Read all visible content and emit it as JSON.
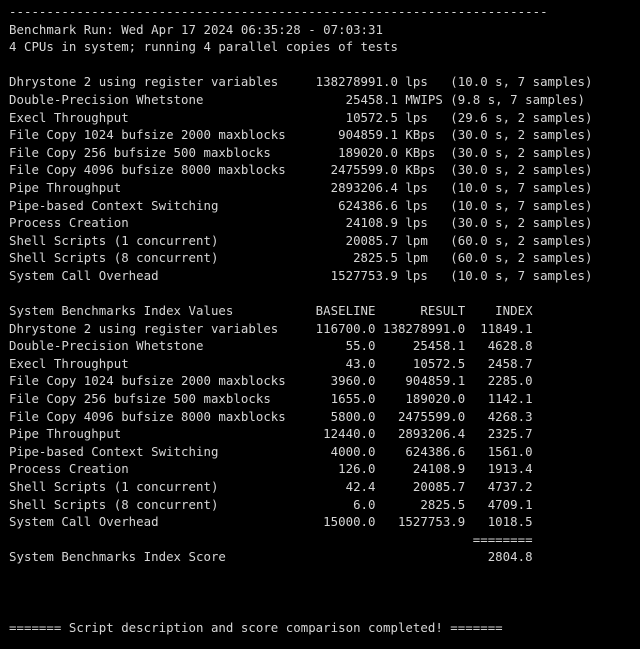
{
  "terminal": {
    "background_color": "#000000",
    "text_color": "#d6d6d6",
    "separator_top": "------------------------------------------------------------------------",
    "benchmark_run_line": "Benchmark Run: Wed Apr 17 2024 06:35:28 - 07:03:31",
    "cpu_line": "4 CPUs in system; running 4 parallel copies of tests",
    "footer_line": "======= Script description and score comparison completed! ======="
  },
  "run_info": {
    "label": "Benchmark Run:",
    "date": "Wed Apr 17 2024",
    "start_time": "06:35:28",
    "end_time": "07:03:31",
    "cpu_count": "4",
    "parallel_copies": "4"
  },
  "raw_results": {
    "rows": [
      {
        "name": "Dhrystone 2 using register variables",
        "value": "138278991.0",
        "unit": "lps",
        "duration": "10.0 s",
        "samples": "7 samples"
      },
      {
        "name": "Double-Precision Whetstone",
        "value": "25458.1",
        "unit": "MWIPS",
        "duration": "9.8 s",
        "samples": "7 samples"
      },
      {
        "name": "Execl Throughput",
        "value": "10572.5",
        "unit": "lps",
        "duration": "29.6 s",
        "samples": "2 samples"
      },
      {
        "name": "File Copy 1024 bufsize 2000 maxblocks",
        "value": "904859.1",
        "unit": "KBps",
        "duration": "30.0 s",
        "samples": "2 samples"
      },
      {
        "name": "File Copy 256 bufsize 500 maxblocks",
        "value": "189020.0",
        "unit": "KBps",
        "duration": "30.0 s",
        "samples": "2 samples"
      },
      {
        "name": "File Copy 4096 bufsize 8000 maxblocks",
        "value": "2475599.0",
        "unit": "KBps",
        "duration": "30.0 s",
        "samples": "2 samples"
      },
      {
        "name": "Pipe Throughput",
        "value": "2893206.4",
        "unit": "lps",
        "duration": "10.0 s",
        "samples": "7 samples"
      },
      {
        "name": "Pipe-based Context Switching",
        "value": "624386.6",
        "unit": "lps",
        "duration": "10.0 s",
        "samples": "7 samples"
      },
      {
        "name": "Process Creation",
        "value": "24108.9",
        "unit": "lps",
        "duration": "30.0 s",
        "samples": "2 samples"
      },
      {
        "name": "Shell Scripts (1 concurrent)",
        "value": "20085.7",
        "unit": "lpm",
        "duration": "60.0 s",
        "samples": "2 samples"
      },
      {
        "name": "Shell Scripts (8 concurrent)",
        "value": "2825.5",
        "unit": "lpm",
        "duration": "60.0 s",
        "samples": "2 samples"
      },
      {
        "name": "System Call Overhead",
        "value": "1527753.9",
        "unit": "lps",
        "duration": "10.0 s",
        "samples": "7 samples"
      }
    ]
  },
  "index_table": {
    "title": "System Benchmarks Index Values",
    "headers": {
      "baseline": "BASELINE",
      "result": "RESULT",
      "index": "INDEX"
    },
    "rows": [
      {
        "name": "Dhrystone 2 using register variables",
        "baseline": "116700.0",
        "result": "138278991.0",
        "index": "11849.1"
      },
      {
        "name": "Double-Precision Whetstone",
        "baseline": "55.0",
        "result": "25458.1",
        "index": "4628.8"
      },
      {
        "name": "Execl Throughput",
        "baseline": "43.0",
        "result": "10572.5",
        "index": "2458.7"
      },
      {
        "name": "File Copy 1024 bufsize 2000 maxblocks",
        "baseline": "3960.0",
        "result": "904859.1",
        "index": "2285.0"
      },
      {
        "name": "File Copy 256 bufsize 500 maxblocks",
        "baseline": "1655.0",
        "result": "189020.0",
        "index": "1142.1"
      },
      {
        "name": "File Copy 4096 bufsize 8000 maxblocks",
        "baseline": "5800.0",
        "result": "2475599.0",
        "index": "4268.3"
      },
      {
        "name": "Pipe Throughput",
        "baseline": "12440.0",
        "result": "2893206.4",
        "index": "2325.7"
      },
      {
        "name": "Pipe-based Context Switching",
        "baseline": "4000.0",
        "result": "624386.6",
        "index": "1561.0"
      },
      {
        "name": "Process Creation",
        "baseline": "126.0",
        "result": "24108.9",
        "index": "1913.4"
      },
      {
        "name": "Shell Scripts (1 concurrent)",
        "baseline": "42.4",
        "result": "20085.7",
        "index": "4737.2"
      },
      {
        "name": "Shell Scripts (8 concurrent)",
        "baseline": "6.0",
        "result": "2825.5",
        "index": "4709.1"
      },
      {
        "name": "System Call Overhead",
        "baseline": "15000.0",
        "result": "1527753.9",
        "index": "1018.5"
      }
    ],
    "rule": "========",
    "score_label": "System Benchmarks Index Score",
    "score_value": "2804.8"
  }
}
